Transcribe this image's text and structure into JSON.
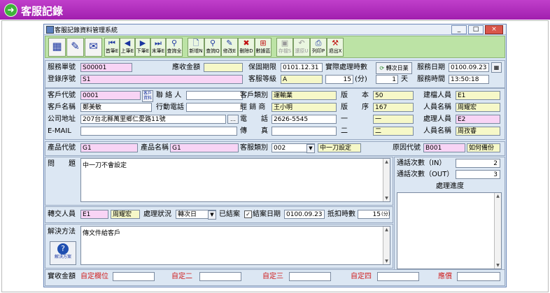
{
  "banner": {
    "title": "客服記錄"
  },
  "window": {
    "title": "客服記錄資料管理系統",
    "controls": [
      "_",
      "□",
      "×"
    ]
  },
  "toolbar": {
    "buttons": [
      "首筆E",
      "上筆E",
      "下筆E",
      "末筆E",
      "查詢全"
    ],
    "actions": [
      "新增N",
      "查詢Q",
      "修改E",
      "刪除D",
      "數據區",
      "存檔S",
      "還原U",
      "列印P",
      "退出X"
    ]
  },
  "hdr": {
    "service_no_label": "服務單號",
    "service_no": "S00001",
    "login_seq_label": "登錄序號",
    "login_seq": "S1",
    "collect_amount_label": "應收金額",
    "collect_amount": "",
    "warranty_label": "保固期限",
    "warranty": "0101.12.31",
    "level_label": "客服等級",
    "level": "A",
    "actual_hours_label": "實際處理時數",
    "actual_hours": "15",
    "minutes_unit": "(分)",
    "convert_date_button": "轉次日業",
    "days_value": "1",
    "days_unit": "天",
    "service_date_label": "服務日期",
    "service_date": "0100.09.23",
    "service_time_label": "服務時間",
    "service_time": "13:50:18"
  },
  "cust": {
    "code_label": "客戶代號",
    "code": "0001",
    "client_button": "客戶資料",
    "contact_label": "聯 絡 人",
    "contact": "",
    "name_label": "客戶名稱",
    "name": "鄭美敏",
    "mobile_label": "行動電話",
    "mobile": "",
    "address_label": "公司地址",
    "address": "207台北縣萬里鄉仁愛路11號",
    "email_label": "E-MAIL",
    "email": "",
    "category_label": "客戶類別",
    "category": "運輸業",
    "dealer_label": "經 銷 商",
    "dealer": "王小明",
    "phone_label": "電　　話",
    "phone": "2626-5545",
    "fax_label": "傳　　真",
    "fax": ""
  },
  "ver": {
    "version_label": "版　　本",
    "version": "50",
    "seq_label": "版　　序",
    "seq": "167",
    "one_label": "一",
    "one": "一",
    "two_label": "二",
    "two": "二"
  },
  "staff": {
    "creator_label": "建檔人員",
    "creator": "E1",
    "creator_name_label": "人員名稱",
    "creator_name": "周耀宏",
    "handler_label": "處理人員",
    "handler": "E2",
    "handler_name_label": "人員名稱",
    "handler_name": "周孜睿"
  },
  "prod": {
    "code_label": "產品代號",
    "code": "G1",
    "name_label": "產品名稱",
    "name": "G1",
    "service_cat_label": "客服類別",
    "service_cat": "002",
    "service_cat_desc": "中一刀設定",
    "reason_label": "原因代號",
    "reason": "B001",
    "reason_desc": "如何備份"
  },
  "problem": {
    "label": "問　　題",
    "text": "中一刀不會設定"
  },
  "calls": {
    "in_label": "通話次數（IN）",
    "in": "2",
    "out_label": "通話次數（OUT）",
    "out": "3",
    "progress_label": "處理進度"
  },
  "transfer": {
    "person_label": "轉交人員",
    "person": "E1",
    "person_name": "周耀宏",
    "status_label": "處理狀況",
    "status": "轉次日",
    "closed_label": "已結案",
    "close_date_label": "結案日期",
    "close_date": "0100.09.23",
    "deduct_label": "抵扣時數",
    "deduct": "15",
    "deduct_unit": "(分)"
  },
  "solution": {
    "label": "解決方法",
    "text": "傳文件給客戶",
    "help_button": "解決方案"
  },
  "footer": {
    "actual_label": "實收金額",
    "actual": "",
    "custom1_label": "自定欄位",
    "custom1": "",
    "custom2_label": "自定二",
    "custom2": "",
    "custom3_label": "自定三",
    "custom3": "",
    "custom4_label": "自定四",
    "custom4": "",
    "arrears_label": "應償",
    "arrears": ""
  }
}
